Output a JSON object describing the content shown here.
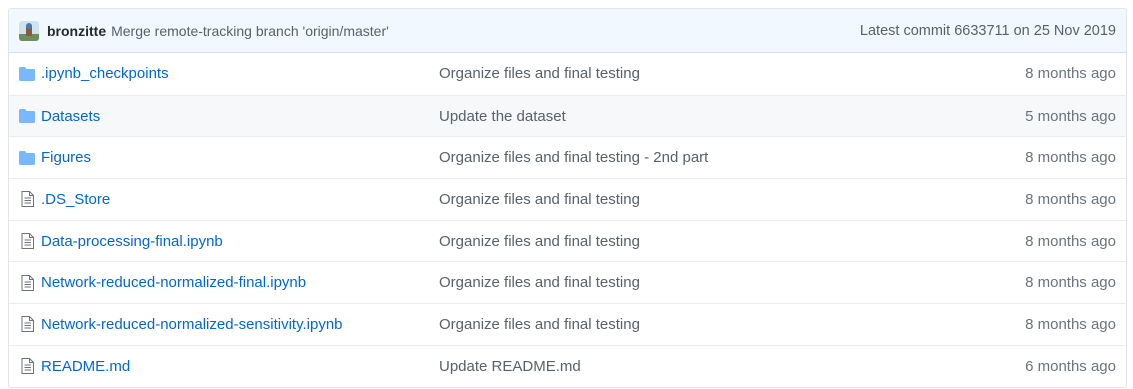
{
  "commit": {
    "author": "bronzitte",
    "message": "Merge remote-tracking branch 'origin/master'",
    "latest": "Latest commit 6633711 on 25 Nov 2019"
  },
  "files": [
    {
      "type": "folder",
      "icon": "folder-icon",
      "name": ".ipynb_checkpoints",
      "message": "Organize files and final testing",
      "age": "8 months ago"
    },
    {
      "type": "folder",
      "icon": "folder-icon",
      "name": "Datasets",
      "message": "Update the dataset",
      "age": "5 months ago"
    },
    {
      "type": "folder",
      "icon": "folder-icon",
      "name": "Figures",
      "message": "Organize files and final testing - 2nd part",
      "age": "8 months ago"
    },
    {
      "type": "file",
      "icon": "file-icon",
      "name": ".DS_Store",
      "message": "Organize files and final testing",
      "age": "8 months ago"
    },
    {
      "type": "file",
      "icon": "file-icon",
      "name": "Data-processing-final.ipynb",
      "message": "Organize files and final testing",
      "age": "8 months ago"
    },
    {
      "type": "file",
      "icon": "file-icon",
      "name": "Network-reduced-normalized-final.ipynb",
      "message": "Organize files and final testing",
      "age": "8 months ago"
    },
    {
      "type": "file",
      "icon": "file-icon",
      "name": "Network-reduced-normalized-sensitivity.ipynb",
      "message": "Organize files and final testing",
      "age": "8 months ago"
    },
    {
      "type": "file",
      "icon": "file-icon",
      "name": "README.md",
      "message": "Update README.md",
      "age": "6 months ago"
    }
  ],
  "colors": {
    "link": "#0366d6",
    "folder": "#79b8ff",
    "file": "#6a737d",
    "commit_bar_bg": "#f1f8ff"
  }
}
